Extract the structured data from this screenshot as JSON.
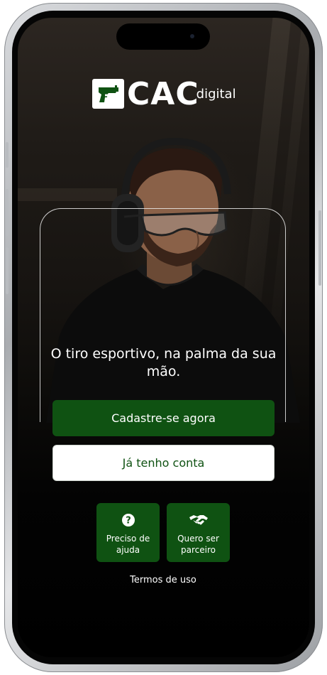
{
  "logo": {
    "text": "CAC",
    "sub": "digital",
    "icon": "pistol-icon"
  },
  "hero": {
    "tagline": "O tiro esportivo, na palma da sua mão."
  },
  "actions": {
    "primary_label": "Cadastre-se agora",
    "secondary_label": "Já tenho conta"
  },
  "tiles": [
    {
      "label": "Preciso de ajuda",
      "icon": "question-icon"
    },
    {
      "label": "Quero ser parceiro",
      "icon": "handshake-icon"
    }
  ],
  "footer": {
    "terms_label": "Termos de uso"
  },
  "colors": {
    "brand_green": "#0f5212",
    "text_light": "#ffffff",
    "background": "#000000"
  }
}
